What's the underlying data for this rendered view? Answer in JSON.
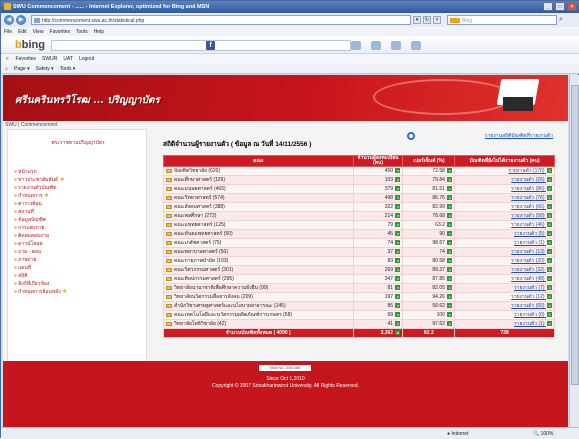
{
  "window": {
    "title": "SWU Commencement - ...... - Internet Explorer, optimized for Bing and MSN",
    "controls": [
      "_",
      "□",
      "×"
    ]
  },
  "address": {
    "url": "http://commencement.swu.ac.th/statistical.php",
    "search_engine": "Bing"
  },
  "menubar": [
    "File",
    "Edit",
    "View",
    "Favorites",
    "Tools",
    "Help"
  ],
  "bingbar": {
    "logo_b": "b",
    "logo_rest": "bing"
  },
  "favorites": [
    "Favorites",
    "SWUR",
    "UAT",
    "Logout"
  ],
  "commandbar": [
    "Page ▾",
    "Safety ▾",
    "Tools ▾"
  ],
  "banner": {
    "title": "ศรีนครินทรวิโรฒ ... ปริญญาบัตร"
  },
  "breadcrumb": "SWU | Commencement",
  "sidebar": {
    "heading": "พระราชทานปริญญาบัตร",
    "items": [
      "หน้าแรก",
      "ข่าวประชาสัมพันธ์",
      "รายงานตัวบัณฑิต",
      "กำหนดการ",
      "ตารางซ้อม",
      "สถานที่",
      "ข้อมูลบัณฑิต",
      "การแต่งกาย",
      "ติดต่อสอบถาม",
      "ดาวน์โหลด",
      "ถาม - ตอบ",
      "ภาพถ่าย",
      "แผนที่",
      "สถิติ",
      "ลิงก์ที่เกี่ยวข้อง",
      "กำหนดการย้อนหลัง"
    ]
  },
  "main": {
    "title": "สถิติจำนวนผู้รายงานตัว ( ข้อมูล ณ วันที่ 14/11/2556 )",
    "report_link": "รายงานสถิติบัณฑิตที่รายงานตัว"
  },
  "table": {
    "headers": [
      "คณะ",
      "จำนวนผู้ลงทะเบียน (คน)",
      "เปอร์เซ็นต์ (%)",
      "บัณฑิตที่ยังไม่ได้รายงานตัว (คน)"
    ],
    "rows": [
      {
        "name": "บัณฑิตวิทยาลัย (620)",
        "count": "450",
        "pct": "72.58",
        "missing": "รายงานตัว (170)"
      },
      {
        "name": "คณะศึกษาศาสตร์ (129)",
        "count": "103",
        "pct": "79.84",
        "missing": "รายงานตัว (26)"
      },
      {
        "name": "คณะมนุษยศาสตร์ (465)",
        "count": "379",
        "pct": "81.51",
        "missing": "รายงานตัว (86)"
      },
      {
        "name": "คณะวิทยาศาสตร์ (574)",
        "count": "498",
        "pct": "86.76",
        "missing": "รายงานตัว (76)"
      },
      {
        "name": "คณะสังคมศาสตร์ (388)",
        "count": "322",
        "pct": "82.99",
        "missing": "รายงานตัว (66)"
      },
      {
        "name": "คณะพลศึกษา (272)",
        "count": "214",
        "pct": "78.68",
        "missing": "รายงานตัว (58)"
      },
      {
        "name": "คณะแพทยศาสตร์ (125)",
        "count": "79",
        "pct": "63.2",
        "missing": "รายงานตัว (46)"
      },
      {
        "name": "คณะทันตแพทยศาสตร์ (50)",
        "count": "45",
        "pct": "90",
        "missing": "รายงานตัว (5)"
      },
      {
        "name": "คณะเภสัชศาสตร์ (75)",
        "count": "74",
        "pct": "98.67",
        "missing": "รายงานตัว (1)"
      },
      {
        "name": "คณะพยาบาลศาสตร์ (50)",
        "count": "37",
        "pct": "74",
        "missing": "รายงานตัว (13)"
      },
      {
        "name": "คณะกายภาพบำบัด (103)",
        "count": "83",
        "pct": "80.58",
        "missing": "รายงานตัว (20)"
      },
      {
        "name": "คณะวิศวกรรมศาสตร์ (301)",
        "count": "269",
        "pct": "89.37",
        "missing": "รายงานตัว (32)"
      },
      {
        "name": "คณะศิลปกรรมศาสตร์ (395)",
        "count": "347",
        "pct": "87.85",
        "missing": "รายงานตัว (48)"
      },
      {
        "name": "วิทยาลัยนานาชาติเพื่อศึกษาความยั่งยืน (99)",
        "count": "81",
        "pct": "82.05",
        "missing": "รายงานตัว (7)"
      },
      {
        "name": "วิทยาลัยนวัตกรรมสื่อสารสังคม (209)",
        "count": "197",
        "pct": "94.26",
        "missing": "รายงานตัว (12)"
      },
      {
        "name": "สำนักวิชาเศรษฐศาสตร์และนโยบายสาธารณะ (145)",
        "count": "85",
        "pct": "58.62",
        "missing": "รายงานตัว (60)"
      },
      {
        "name": "คณะเทคโนโลยีและนวัตกรรมผลิตภัณฑ์การเกษตร (58)",
        "count": "58",
        "pct": "100",
        "missing": "รายงานตัว (0)"
      },
      {
        "name": "วิทยาลัยโพธิวิชาลัย (42)",
        "count": "41",
        "pct": "97.62",
        "missing": "รายงานตัว (1)"
      }
    ],
    "total": {
      "label": "จำนวนบัณฑิตทั้งหมด ( 4090 )",
      "count": "3,362",
      "pct": "82.2",
      "missing": "728"
    }
  },
  "footer": {
    "counter": "Visit No. 245,486",
    "line1": "Since Oct 1,2010",
    "line2": "Copyright © 2007 Srinakharinwirot University. All Rights Reserved."
  },
  "status": {
    "zone": "Internet",
    "zoom": "100%"
  }
}
